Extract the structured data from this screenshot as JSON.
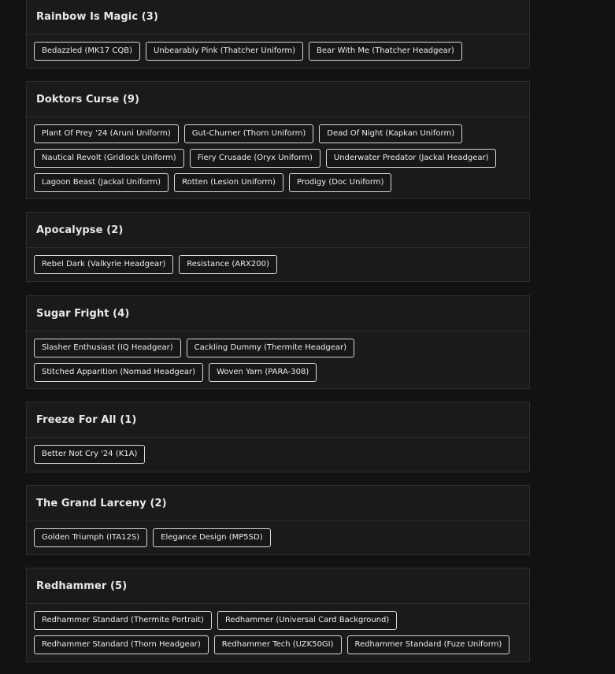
{
  "sections": [
    {
      "title": "Rainbow Is Magic (3)",
      "items": [
        "Bedazzled (MK17 CQB)",
        "Unbearably Pink (Thatcher Uniform)",
        "Bear With Me (Thatcher Headgear)"
      ]
    },
    {
      "title": "Doktors Curse (9)",
      "items": [
        "Plant Of Prey '24 (Aruni Uniform)",
        "Gut-Churner (Thorn Uniform)",
        "Dead Of Night (Kapkan Uniform)",
        "Nautical Revolt (Gridlock Uniform)",
        "Fiery Crusade (Oryx Uniform)",
        "Underwater Predator (Jackal Headgear)",
        "Lagoon Beast (Jackal Uniform)",
        "Rotten (Lesion Uniform)",
        "Prodigy (Doc Uniform)"
      ]
    },
    {
      "title": "Apocalypse (2)",
      "items": [
        "Rebel Dark (Valkyrie Headgear)",
        "Resistance (ARX200)"
      ]
    },
    {
      "title": "Sugar Fright (4)",
      "items": [
        "Slasher Enthusiast (IQ Headgear)",
        "Cackling Dummy (Thermite Headgear)",
        "Stitched Apparition (Nomad Headgear)",
        "Woven Yarn (PARA-308)"
      ]
    },
    {
      "title": "Freeze For All (1)",
      "items": [
        "Better Not Cry '24 (K1A)"
      ]
    },
    {
      "title": "The Grand Larceny (2)",
      "items": [
        "Golden Triumph (ITA12S)",
        "Elegance Design (MP5SD)"
      ]
    },
    {
      "title": "Redhammer (5)",
      "items": [
        "Redhammer Standard (Thermite Portrait)",
        "Redhammer (Universal Card Background)",
        "Redhammer Standard (Thorn Headgear)",
        "Redhammer Tech (UZK50GI)",
        "Redhammer Standard (Fuze Uniform)"
      ]
    }
  ]
}
